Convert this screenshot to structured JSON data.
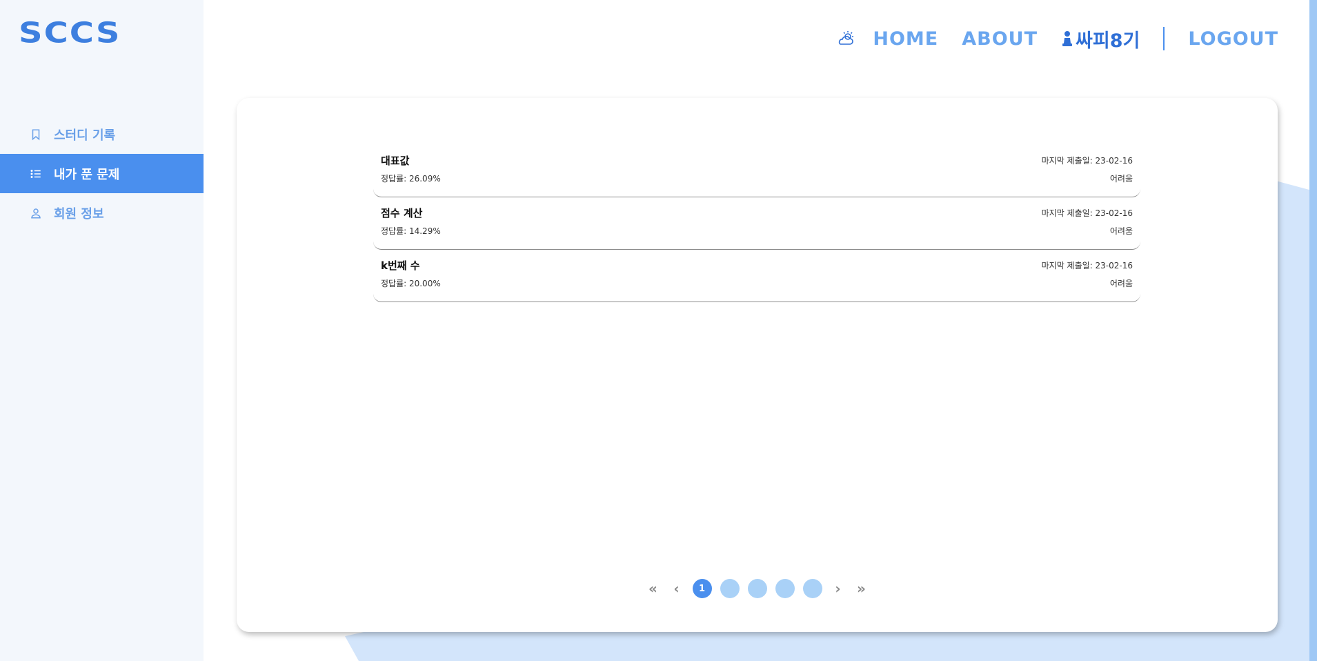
{
  "logo": "SCCS",
  "sidebar": {
    "items": [
      {
        "label": "스터디 기록",
        "icon": "bookmark-icon",
        "active": false
      },
      {
        "label": "내가 푼 문제",
        "icon": "list-icon",
        "active": true
      },
      {
        "label": "회원 정보",
        "icon": "user-icon",
        "active": false
      }
    ]
  },
  "header": {
    "weather_icon": "weather-icon",
    "home": "HOME",
    "about": "ABOUT",
    "team": "싸피8기",
    "team_icon": "chess-pawn-icon",
    "logout": "LOGOUT"
  },
  "problems": [
    {
      "title": "대표값",
      "rate": "정답률: 26.09%",
      "date": "마지막 제출일: 23-02-16",
      "level": "어려움"
    },
    {
      "title": "점수 계산",
      "rate": "정답률: 14.29%",
      "date": "마지막 제출일: 23-02-16",
      "level": "어려움"
    },
    {
      "title": "k번째 수",
      "rate": "정답률: 20.00%",
      "date": "마지막 제출일: 23-02-16",
      "level": "어려움"
    }
  ],
  "pagination": {
    "first": "«",
    "prev": "‹",
    "next": "›",
    "last": "»",
    "pages": [
      "1",
      "",
      "",
      "",
      ""
    ],
    "current": "1"
  },
  "colors": {
    "accent": "#4a8fee",
    "sidebar_bg": "#f3f7fc",
    "pager_inactive": "#a9d1f7",
    "bg_shape": "#d3e5fb"
  }
}
